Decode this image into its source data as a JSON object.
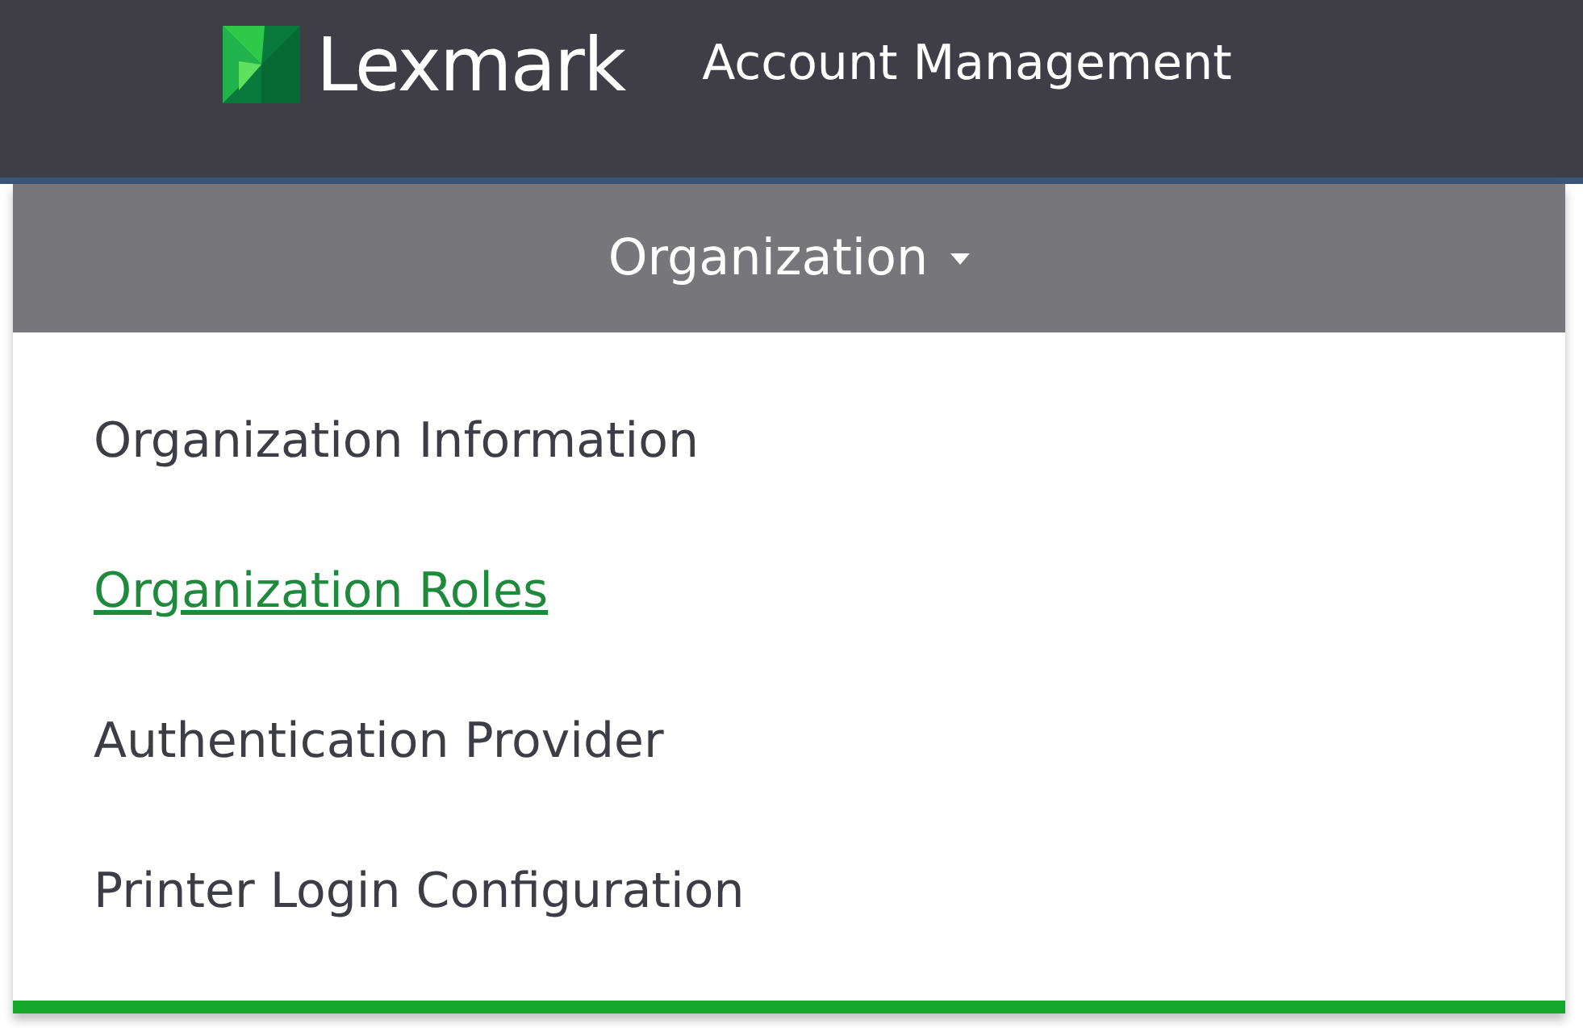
{
  "header": {
    "brand": "Lexmark",
    "title": "Account Management"
  },
  "nav": {
    "label": "Organization",
    "expanded": true
  },
  "menu": [
    {
      "label": "Organization Information",
      "selected": false
    },
    {
      "label": "Organization Roles",
      "selected": true
    },
    {
      "label": "Authentication Provider",
      "selected": false
    },
    {
      "label": "Printer Login Configuration",
      "selected": false
    }
  ]
}
